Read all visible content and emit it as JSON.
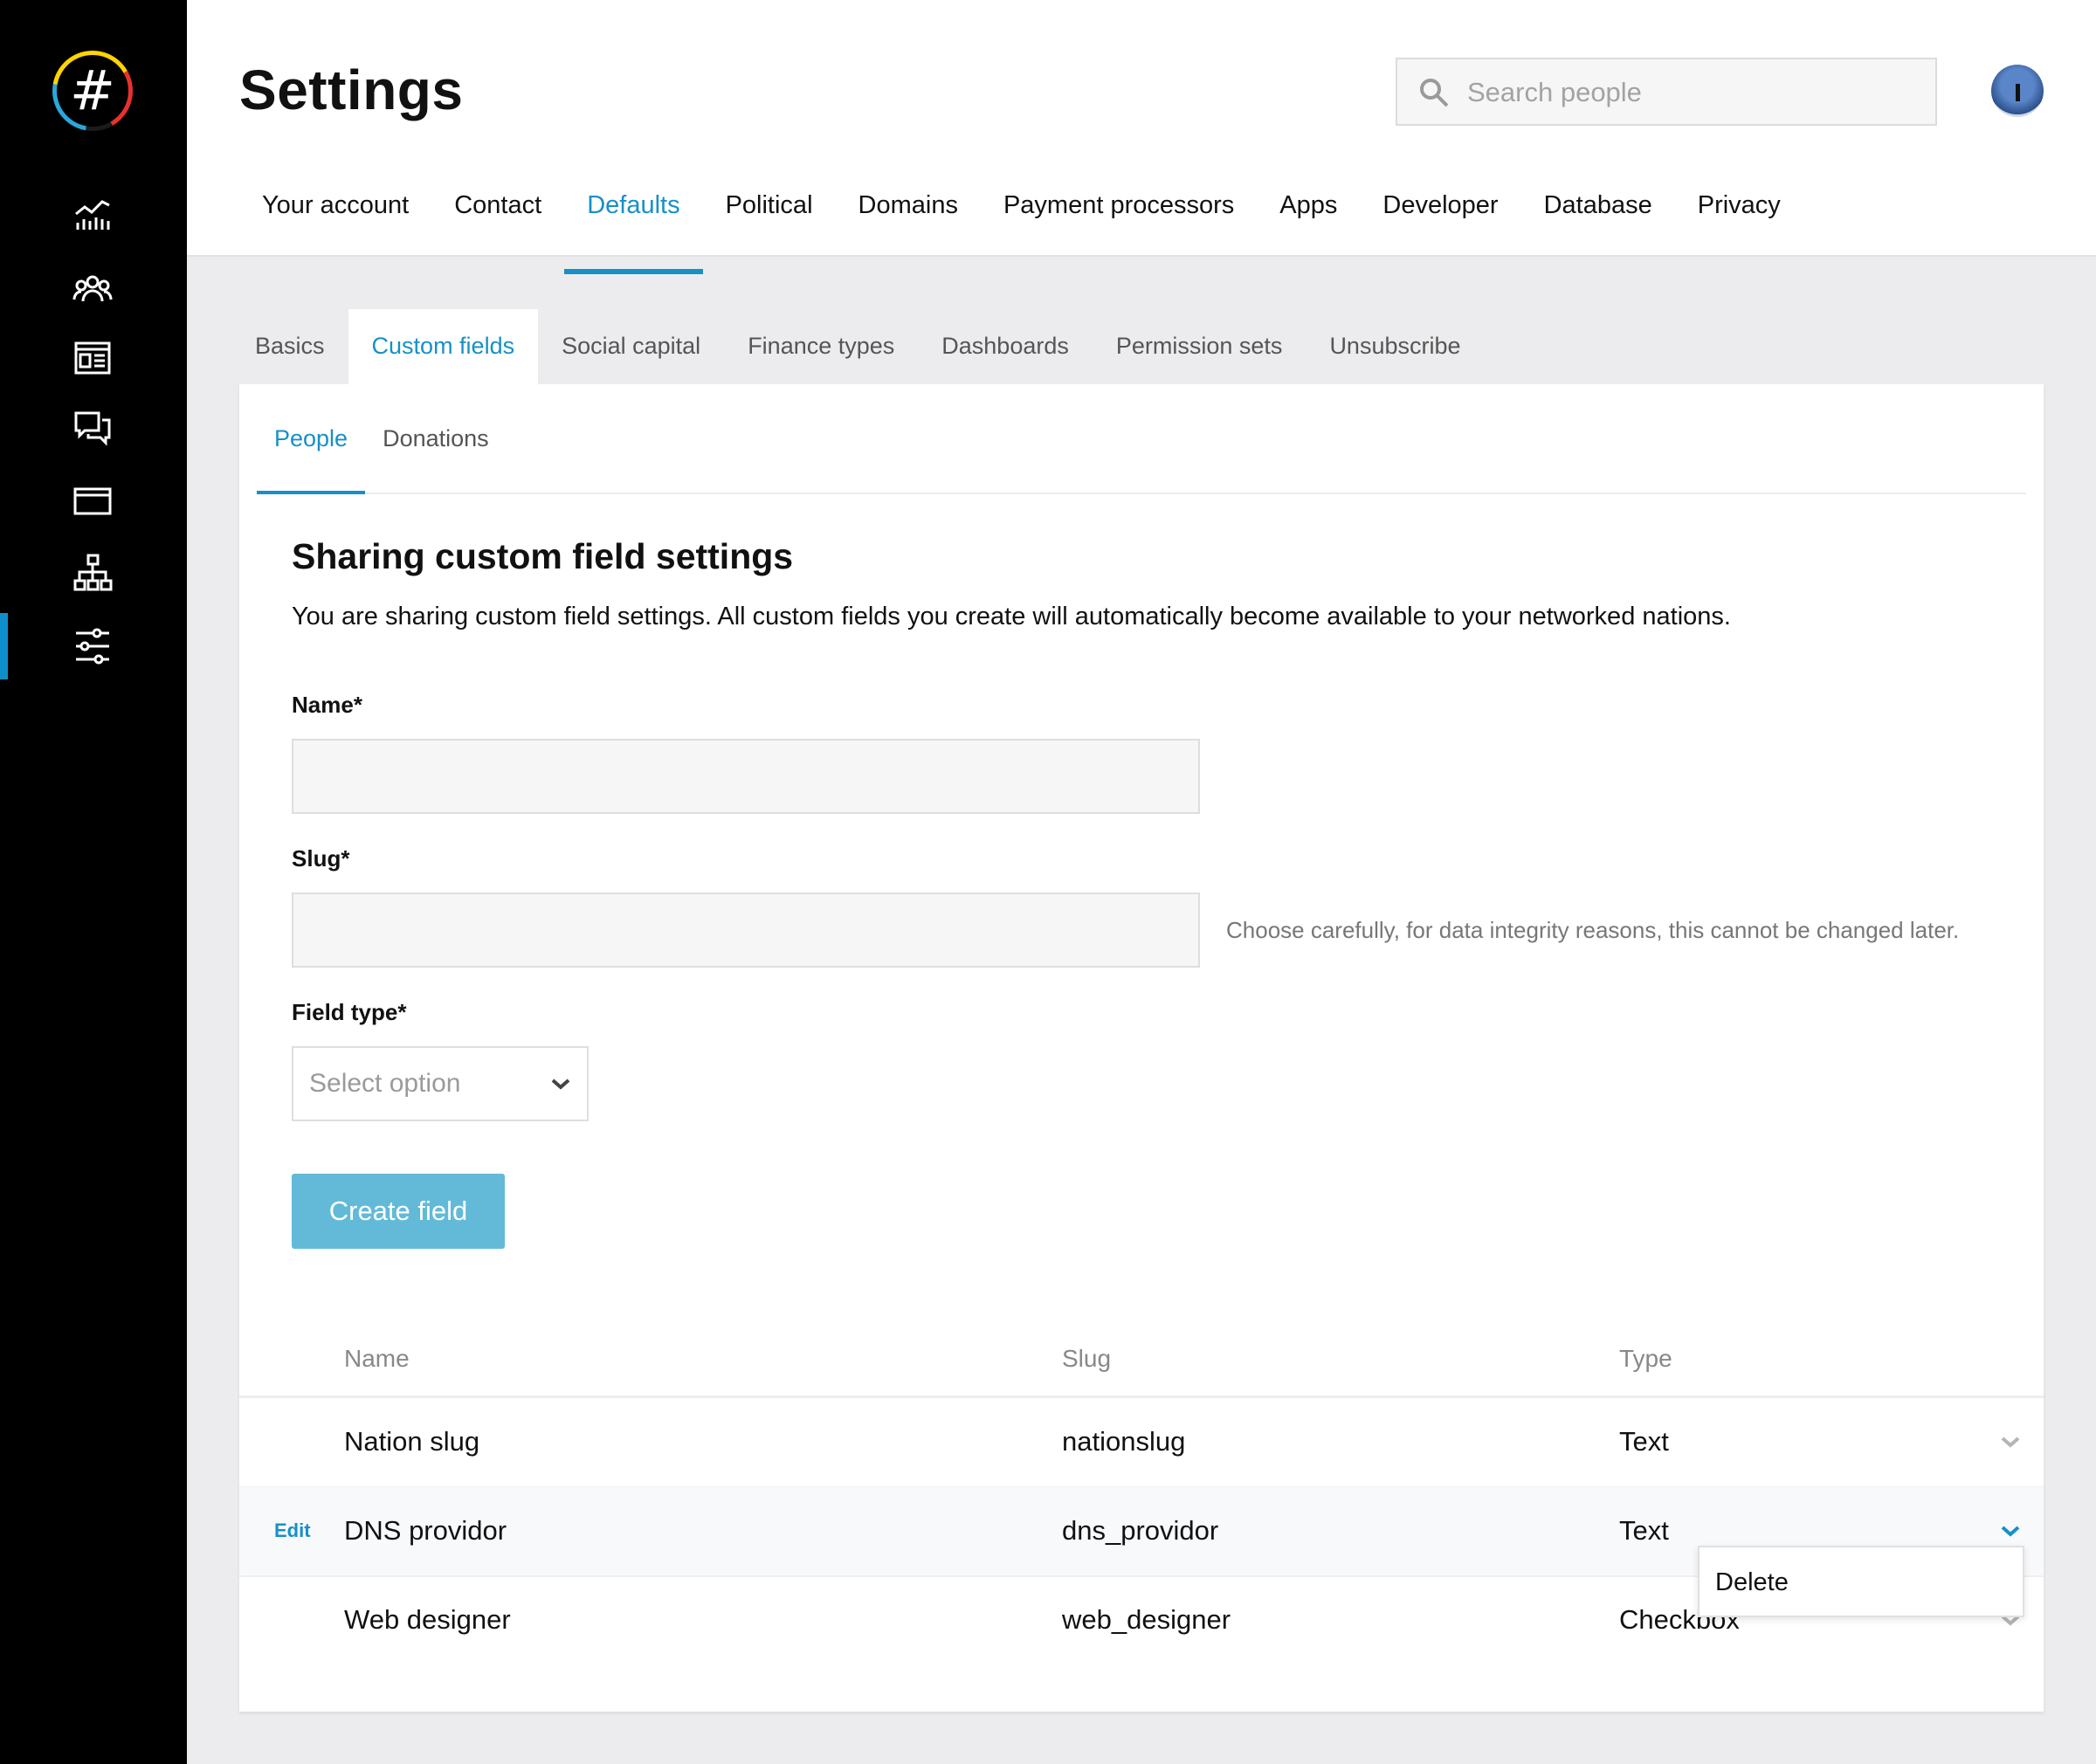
{
  "app": {
    "logo_glyph": "#",
    "accent_color": "#1790c7",
    "button_color": "#62bad8"
  },
  "sidebar": {
    "items": [
      {
        "icon": "analytics-icon"
      },
      {
        "icon": "people-icon"
      },
      {
        "icon": "website-icon"
      },
      {
        "icon": "communications-icon"
      },
      {
        "icon": "finances-icon"
      },
      {
        "icon": "network-icon"
      },
      {
        "icon": "settings-sliders-icon",
        "active": true
      }
    ]
  },
  "header": {
    "title": "Settings",
    "search_placeholder": "Search people",
    "tabs": [
      "Your account",
      "Contact",
      "Defaults",
      "Political",
      "Domains",
      "Payment processors",
      "Apps",
      "Developer",
      "Database",
      "Privacy"
    ],
    "active_tab": "Defaults"
  },
  "sub_tabs": {
    "items": [
      "Basics",
      "Custom fields",
      "Social capital",
      "Finance types",
      "Dashboards",
      "Permission sets",
      "Unsubscribe"
    ],
    "active": "Custom fields"
  },
  "inner_tabs": {
    "items": [
      "People",
      "Donations"
    ],
    "active": "People"
  },
  "section": {
    "title": "Sharing custom field settings",
    "description": "You are sharing custom field settings. All custom fields you create will automatically become available to your networked nations."
  },
  "form": {
    "name_label": "Name*",
    "name_value": "",
    "slug_label": "Slug*",
    "slug_value": "",
    "slug_hint": "Choose carefully, for data integrity reasons, this cannot be changed later.",
    "field_type_label": "Field type*",
    "field_type_placeholder": "Select option",
    "create_button": "Create field"
  },
  "table": {
    "headers": [
      "Name",
      "Slug",
      "Type"
    ],
    "rows": [
      {
        "name": "Nation slug",
        "slug": "nationslug",
        "type": "Text"
      },
      {
        "name": "DNS providor",
        "slug": "dns_providor",
        "type": "Text",
        "edit_label": "Edit",
        "hovered": true
      },
      {
        "name": "Web designer",
        "slug": "web_designer",
        "type": "Checkbox"
      }
    ],
    "dropdown_item": "Delete"
  }
}
